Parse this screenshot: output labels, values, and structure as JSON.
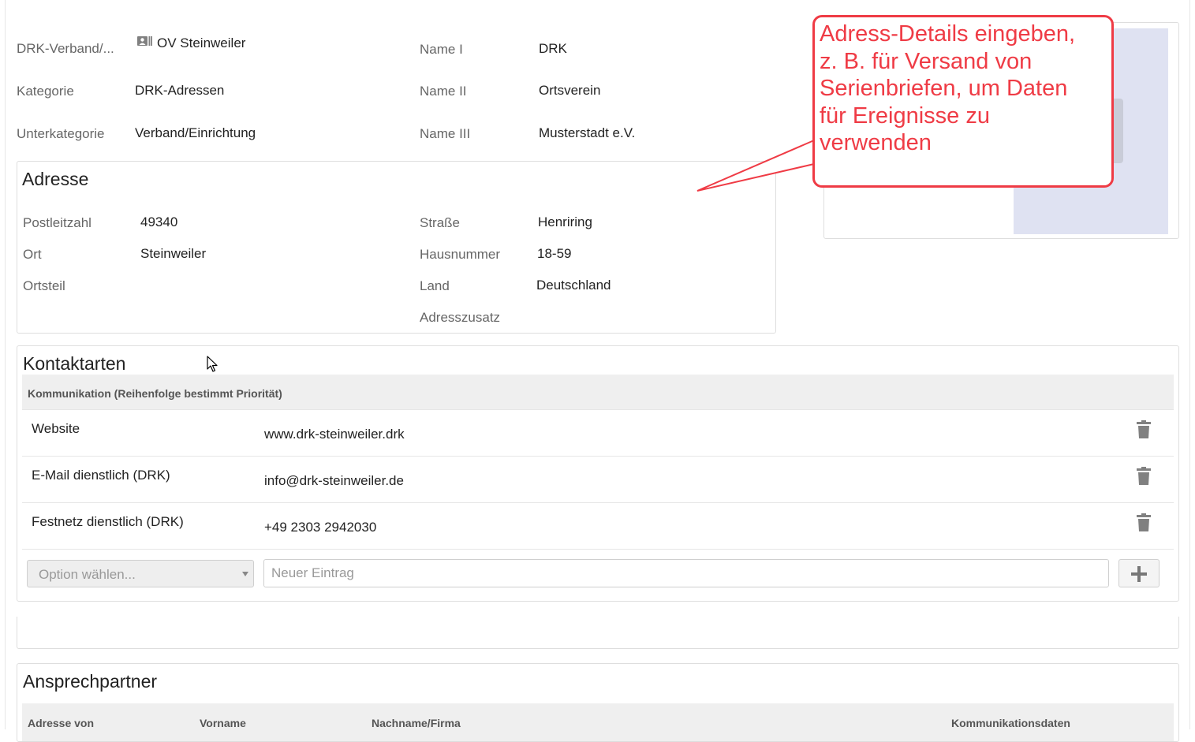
{
  "header_fields": {
    "verband_label": "DRK-Verband/...",
    "verband_value": "OV Steinweiler",
    "kategorie_label": "Kategorie",
    "kategorie_value": "DRK-Adressen",
    "unterkategorie_label": "Unterkategorie",
    "unterkategorie_value": "Verband/Einrichtung",
    "name1_label": "Name I",
    "name1_value": "DRK",
    "name2_label": "Name II",
    "name2_value": "Ortsverein",
    "name3_label": "Name III",
    "name3_value": "Musterstadt e.V."
  },
  "adresse": {
    "title": "Adresse",
    "plz_label": "Postleitzahl",
    "plz_value": "49340",
    "ort_label": "Ort",
    "ort_value": "Steinweiler",
    "ortsteil_label": "Ortsteil",
    "ortsteil_value": "",
    "strasse_label": "Straße",
    "strasse_value": "Henriring",
    "hausnummer_label": "Hausnummer",
    "hausnummer_value": "18-59",
    "land_label": "Land",
    "land_value": "Deutschland",
    "adresszusatz_label": "Adresszusatz",
    "adresszusatz_value": ""
  },
  "kontaktarten": {
    "title": "Kontaktarten",
    "table_header": "Kommunikation (Reihenfolge bestimmt Priorität)",
    "rows": [
      {
        "type": "Website",
        "value": "www.drk-steinweiler.drk"
      },
      {
        "type": "E-Mail dienstlich (DRK)",
        "value": "info@drk-steinweiler.de"
      },
      {
        "type": "Festnetz dienstlich (DRK)",
        "value": "+49 2303 2942030"
      }
    ],
    "select_placeholder": "Option wählen...",
    "input_placeholder": "Neuer Eintrag"
  },
  "ansprechpartner": {
    "title": "Ansprechpartner",
    "columns": [
      "Adresse von",
      "Vorname",
      "Nachname/Firma",
      "Kommunikationsdaten"
    ]
  },
  "callout": {
    "lines": [
      "Adress-Details eingeben,",
      "z. B. für Versand von",
      "Serienbriefen, um Daten",
      "für Ereignisse zu",
      "verwenden"
    ]
  },
  "colors": {
    "callout_red": "#ef3b45",
    "photo_placeholder": "#dfe2f2",
    "icon_gray": "#808080"
  },
  "icons": {
    "verband": "id-card-icon",
    "delete": "trash-icon",
    "add": "plus-icon",
    "select_caret": "caret-down-icon",
    "cursor": "mouse-pointer-icon"
  }
}
